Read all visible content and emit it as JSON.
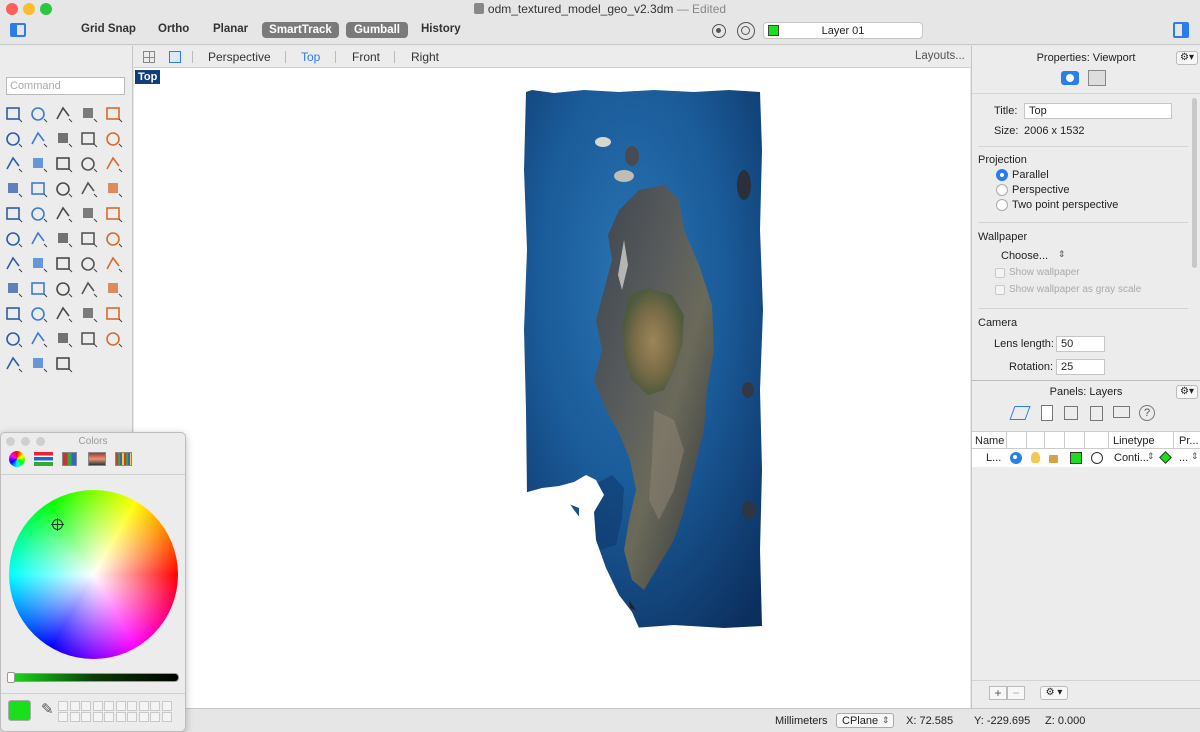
{
  "window": {
    "title": "odm_textured_model_geo_v2.3dm",
    "edited": "— Edited"
  },
  "toolbar": {
    "items": [
      "Grid Snap",
      "Ortho",
      "Planar",
      "SmartTrack",
      "Gumball",
      "History"
    ],
    "layer_name": "Layer 01",
    "layer_color": "#19e01a"
  },
  "command": {
    "placeholder": "Command"
  },
  "viewport_tabs": {
    "tabs": [
      "Perspective",
      "Top",
      "Front",
      "Right"
    ],
    "active": "Top",
    "layouts": "Layouts..."
  },
  "viewport": {
    "label": "Top"
  },
  "properties": {
    "header": "Properties: Viewport",
    "title_label": "Title:",
    "title_value": "Top",
    "size_label": "Size:",
    "size_value": "2006 x 1532",
    "projection_heading": "Projection",
    "projection_options": [
      "Parallel",
      "Perspective",
      "Two point perspective"
    ],
    "projection_selected": "Parallel",
    "wallpaper_heading": "Wallpaper",
    "wallpaper_choose": "Choose...",
    "show_wallpaper": "Show wallpaper",
    "show_wallpaper_gray": "Show wallpaper as gray scale",
    "camera_heading": "Camera",
    "lens_label": "Lens length:",
    "lens_value": "50",
    "rotation_label": "Rotation:",
    "rotation_value": "25"
  },
  "layers": {
    "header": "Panels: Layers",
    "columns": {
      "name": "Name",
      "linetype": "Linetype",
      "print": "Pr..."
    },
    "row": {
      "name": "L...",
      "linetype": "Conti...",
      "print": "..."
    },
    "row_color": "#19e01a"
  },
  "colors_panel": {
    "title": "Colors",
    "current_color": "#19e01a"
  },
  "status": {
    "units": "Millimeters",
    "cplane": "CPlane",
    "x": "X: 72.585",
    "y": "Y: -229.695",
    "z": "Z: 0.000"
  }
}
